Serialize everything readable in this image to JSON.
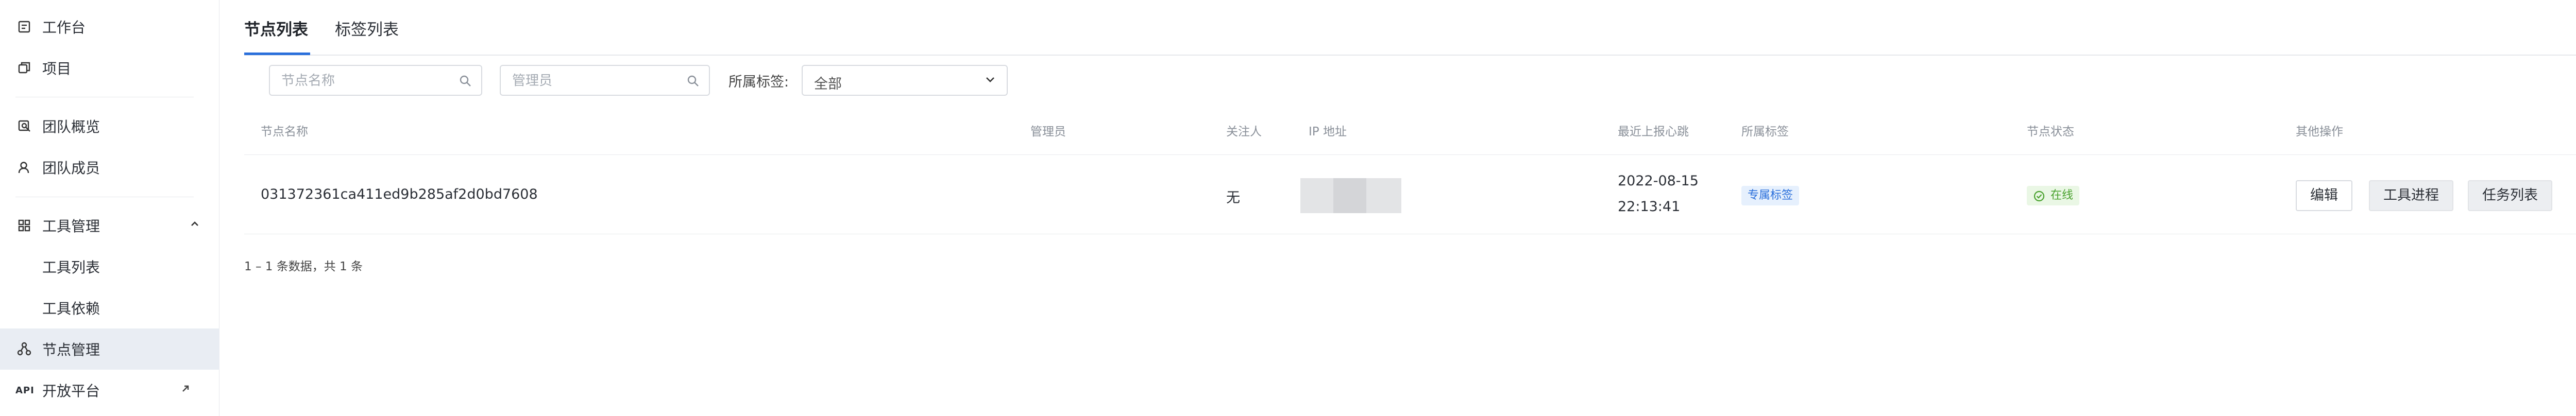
{
  "sidebar": {
    "items": [
      {
        "label": "工作台",
        "icon": "dashboard-icon"
      },
      {
        "label": "项目",
        "icon": "projects-icon"
      },
      {
        "label": "团队概览",
        "icon": "team-overview-icon"
      },
      {
        "label": "团队成员",
        "icon": "user-icon"
      },
      {
        "label": "工具管理",
        "icon": "grid-icon",
        "expanded": true
      },
      {
        "label": "工具列表"
      },
      {
        "label": "工具依赖"
      },
      {
        "label": "节点管理",
        "icon": "nodes-icon",
        "active": true
      },
      {
        "label": "开放平台",
        "prefix": "API",
        "icon": "external-link-icon"
      }
    ]
  },
  "tabs": [
    {
      "label": "节点列表",
      "active": true
    },
    {
      "label": "标签列表",
      "active": false
    }
  ],
  "filters": {
    "node_name_placeholder": "节点名称",
    "admin_placeholder": "管理员",
    "tag_label": "所属标签:",
    "tag_value": "全部"
  },
  "table": {
    "headers": [
      "节点名称",
      "管理员",
      "关注人",
      "IP 地址",
      "最近上报心跳",
      "所属标签",
      "节点状态",
      "其他操作"
    ],
    "rows": [
      {
        "name": "031372361ca411ed9b285af2d0bd7608",
        "admin": "",
        "follower": "无",
        "ip": "",
        "heartbeat_date": "2022-08-15",
        "heartbeat_time": "22:13:41",
        "tag": "专属标签",
        "status": "在线",
        "actions": [
          "编辑",
          "工具进程",
          "任务列表"
        ]
      }
    ]
  },
  "summary": "1 – 1 条数据，共 1 条",
  "colors": {
    "accent": "#2a6fdb",
    "active_nav_bg": "#e9edf3",
    "online_green": "#4aa22f",
    "tag_blue_bg": "#e6f0fd"
  }
}
